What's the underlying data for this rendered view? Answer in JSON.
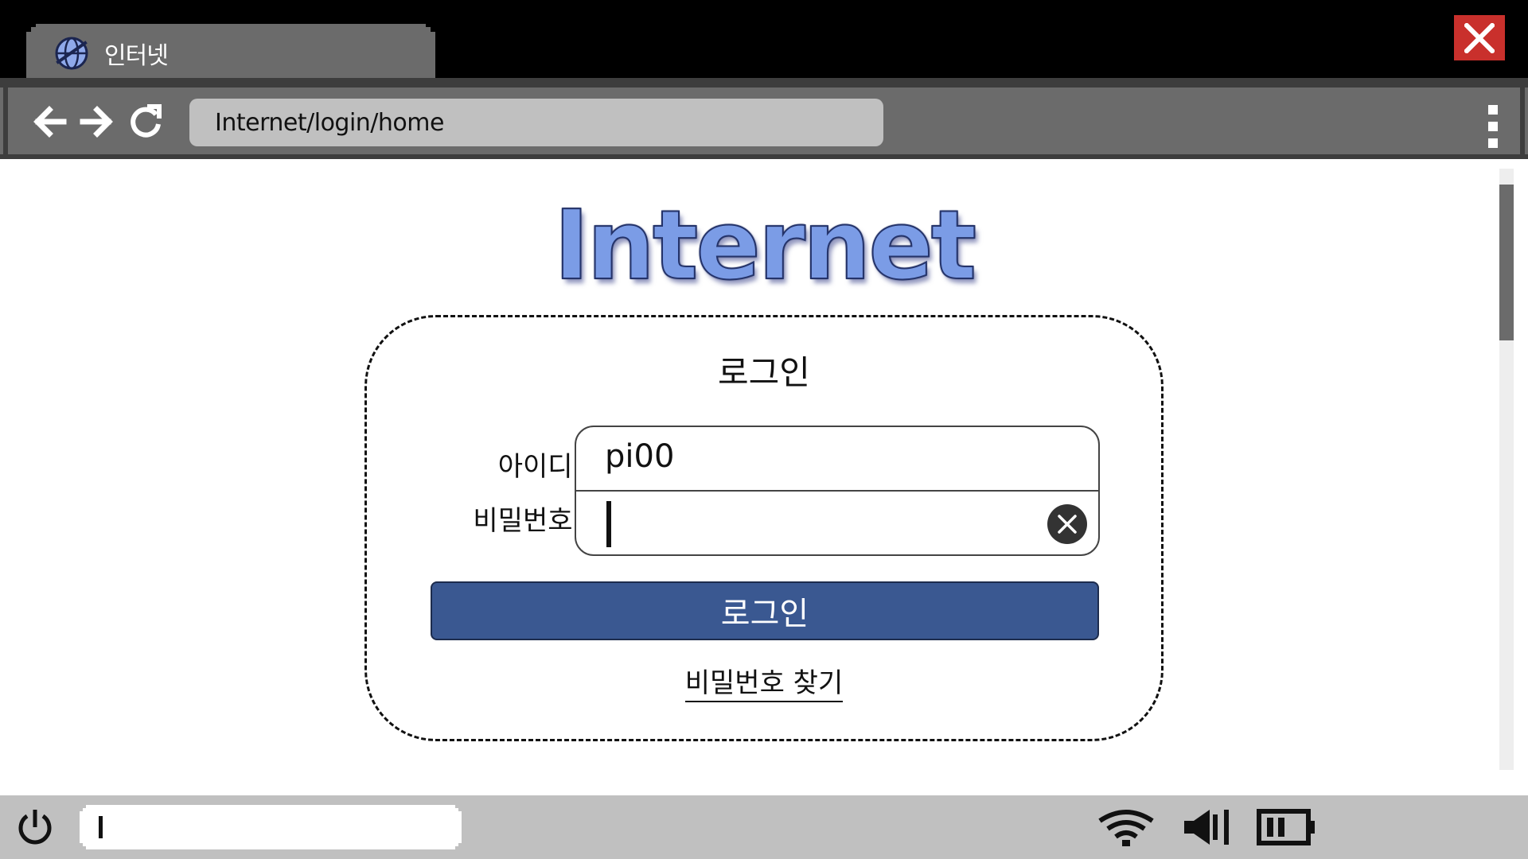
{
  "window": {
    "tab_title": "인터넷",
    "tab_icon": "globe-icon",
    "close_icon": "close-icon",
    "accent_close": "#c9302c"
  },
  "toolbar": {
    "back_icon": "back-arrow-icon",
    "forward_icon": "forward-arrow-icon",
    "reload_icon": "reload-icon",
    "address": "Internet/login/home",
    "menu_icon": "more-vertical-icon"
  },
  "page": {
    "logo": "Internet",
    "logo_color": "#7b9ce6",
    "login": {
      "heading": "로그인",
      "id_label": "아이디:",
      "id_value": "pi00",
      "password_label": "비밀번호:",
      "password_value": "",
      "submit_label": "로그인",
      "submit_color": "#3a5891",
      "find_password_link": "비밀번호 찾기"
    }
  },
  "taskbar": {
    "power_icon": "power-icon",
    "search_value": "",
    "wifi_icon": "wifi-icon",
    "volume_icon": "volume-icon",
    "battery_icon": "battery-icon",
    "battery_level": 0.5
  }
}
